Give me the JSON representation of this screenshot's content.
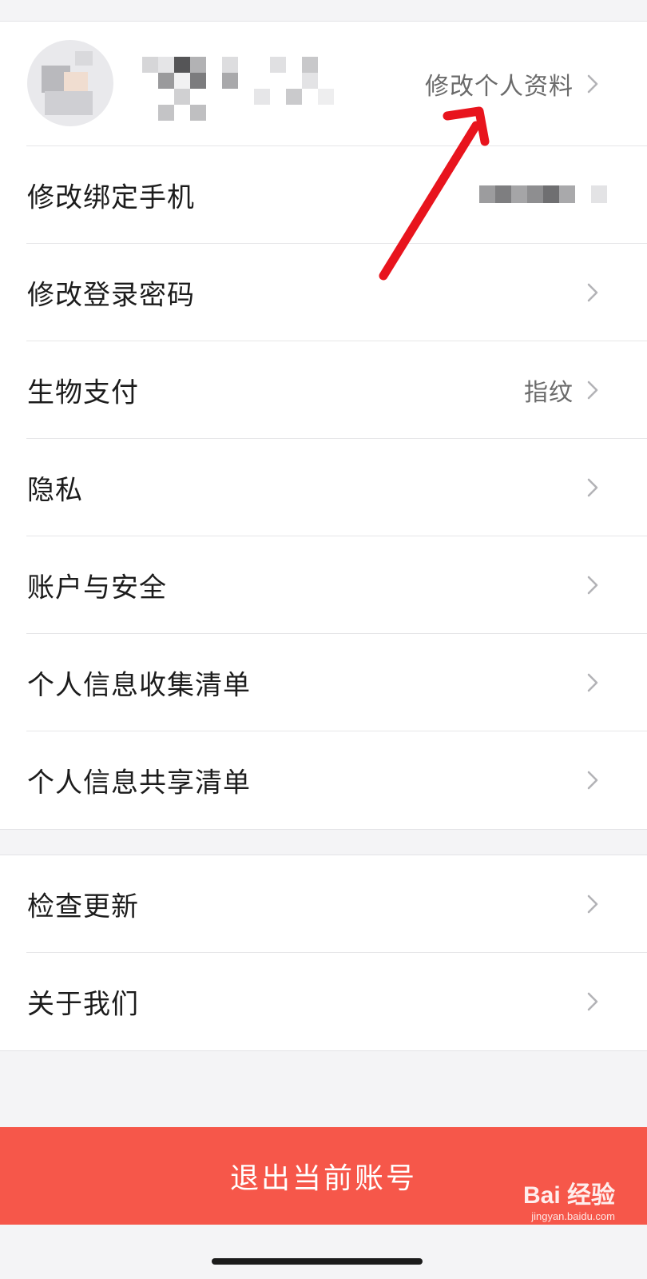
{
  "profile": {
    "edit_label": "修改个人资料"
  },
  "settings_group1": [
    {
      "label": "修改绑定手机",
      "value": ""
    },
    {
      "label": "修改登录密码",
      "value": ""
    },
    {
      "label": "生物支付",
      "value": "指纹"
    },
    {
      "label": "隐私",
      "value": ""
    },
    {
      "label": "账户与安全",
      "value": ""
    },
    {
      "label": "个人信息收集清单",
      "value": ""
    },
    {
      "label": "个人信息共享清单",
      "value": ""
    }
  ],
  "settings_group2": [
    {
      "label": "检查更新"
    },
    {
      "label": "关于我们"
    }
  ],
  "logout": {
    "label": "退出当前账号"
  },
  "watermark": {
    "brand": "Bai  经验",
    "url": "jingyan.baidu.com"
  },
  "colors": {
    "accent": "#f6574a",
    "annotation_arrow": "#e8141d",
    "background": "#f4f4f6"
  },
  "icons": {
    "row_chevron": "chevron-right-icon",
    "annotation": "red-arrow-icon"
  }
}
